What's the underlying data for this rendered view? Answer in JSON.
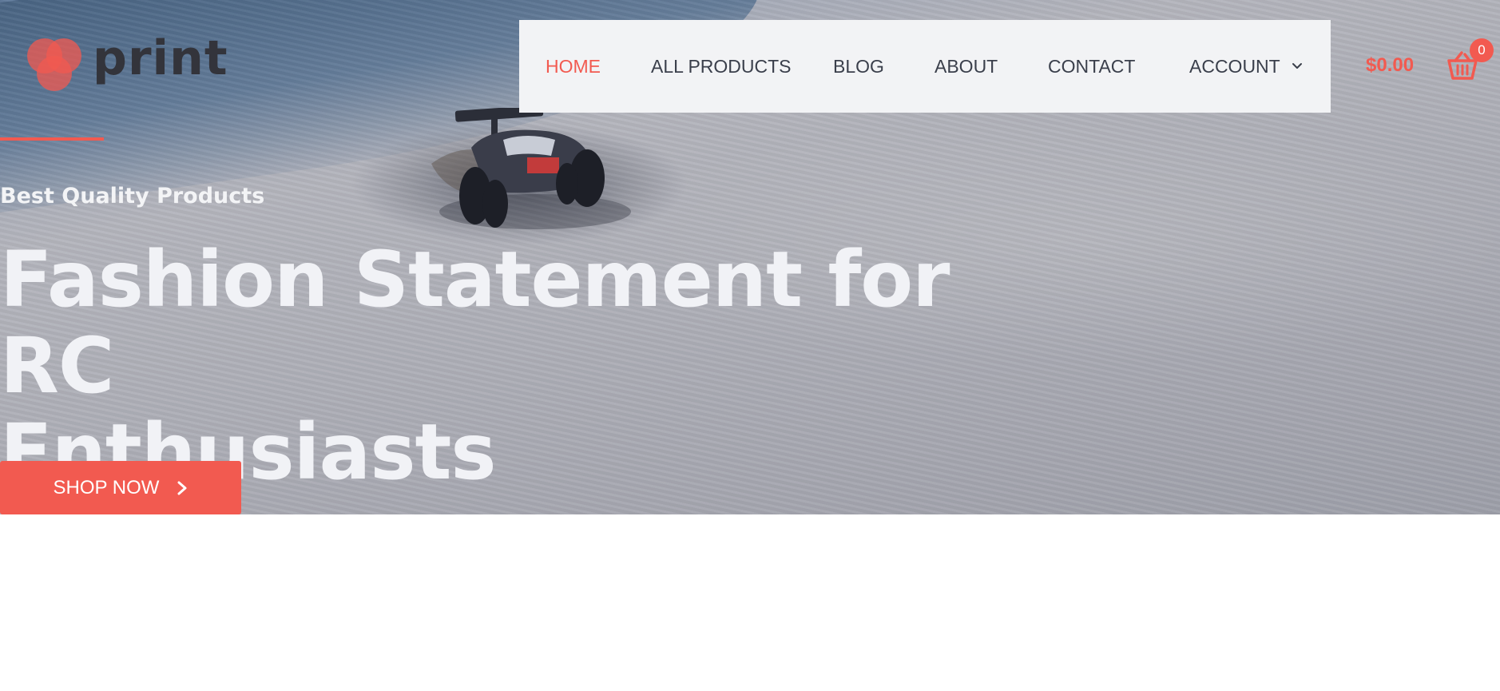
{
  "logo": {
    "text": "print"
  },
  "nav": {
    "items": [
      {
        "label": "HOME",
        "active": true
      },
      {
        "label": "ALL PRODUCTS",
        "active": false
      },
      {
        "label": "BLOG",
        "active": false
      },
      {
        "label": "ABOUT",
        "active": false
      },
      {
        "label": "CONTACT",
        "active": false
      },
      {
        "label": "ACCOUNT",
        "active": false,
        "dropdown": true
      }
    ]
  },
  "cart": {
    "total": "$0.00",
    "count": "0",
    "icon": "basket-icon"
  },
  "hero": {
    "tagline": "Best Quality Products",
    "headline_line1": "Fashion Statement for RC",
    "headline_line2": "Enthusiasts",
    "cta_label": "SHOP NOW",
    "cta_icon": "chevron-right-icon"
  },
  "colors": {
    "accent": "#f25a50",
    "nav_bg": "#f2f3f5",
    "nav_text": "#3a3f4b",
    "logo_text": "#33343b",
    "hero_text": "#f1f2f6"
  }
}
